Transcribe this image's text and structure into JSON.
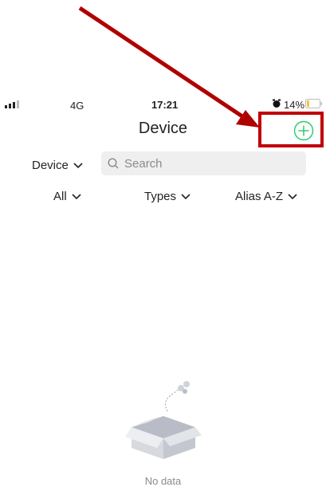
{
  "status_bar": {
    "network": "4G",
    "time": "17:21",
    "battery": "14%"
  },
  "header": {
    "title": "Device"
  },
  "filters": {
    "device_label": "Device",
    "search_placeholder": "Search",
    "all_label": "All",
    "types_label": "Types",
    "sort_label": "Alias A-Z"
  },
  "empty_state": {
    "text": "No data"
  },
  "colors": {
    "accent": "#2ecc71",
    "annotation": "#c00000",
    "battery_low": "#f5c242"
  }
}
